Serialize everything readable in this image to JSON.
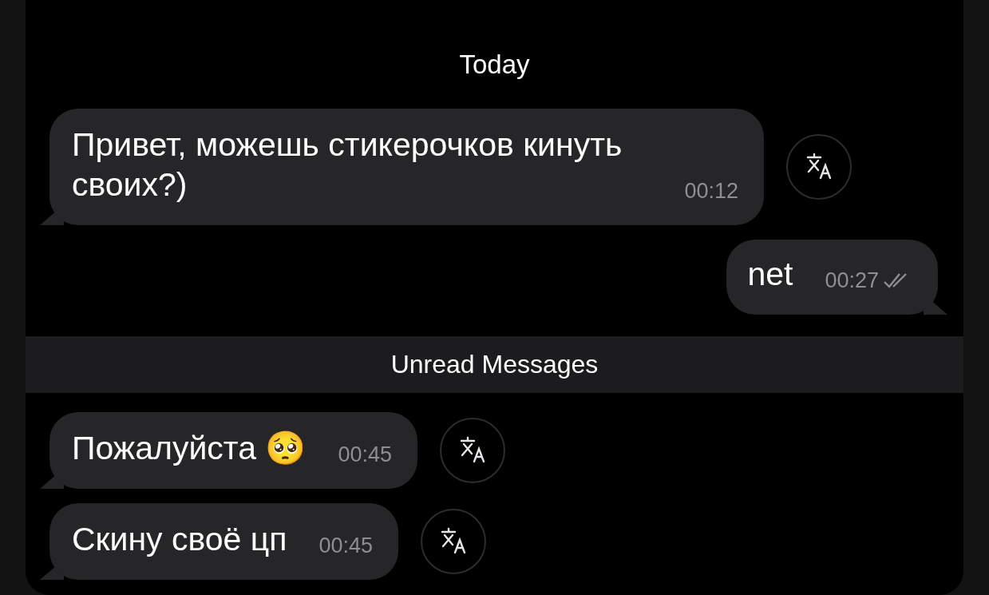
{
  "items": [
    {
      "kind": "date",
      "text": "Today"
    },
    {
      "kind": "message",
      "outgoing": false,
      "text": "Привет, можешь стикерочков кинуть своих?)",
      "time": "00:12"
    },
    {
      "kind": "message",
      "outgoing": true,
      "text": "net",
      "time": "00:27",
      "read": true
    },
    {
      "kind": "divider",
      "text": "Unread Messages"
    },
    {
      "kind": "message",
      "outgoing": false,
      "text": "Пожалуйста 🥺",
      "time": "00:45"
    },
    {
      "kind": "message",
      "outgoing": false,
      "text": "Скину своё цп",
      "time": "00:45"
    }
  ]
}
